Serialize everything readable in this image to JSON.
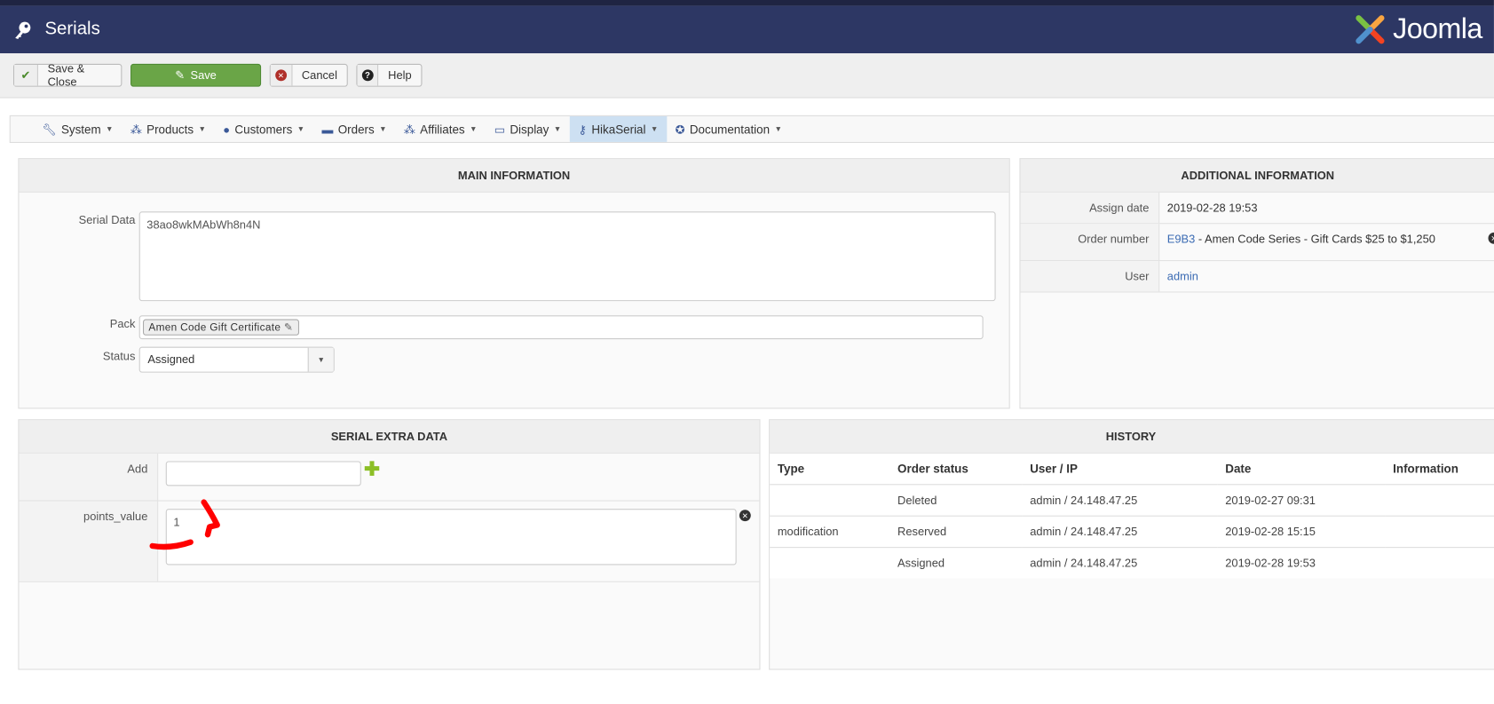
{
  "header": {
    "title": "Serials",
    "logo_text": "Joomla!"
  },
  "toolbar": {
    "save_close": "Save & Close",
    "save": "Save",
    "cancel": "Cancel",
    "help": "Help"
  },
  "menu": [
    {
      "label": "System",
      "icon": "wrench-icon"
    },
    {
      "label": "Products",
      "icon": "cubes-icon"
    },
    {
      "label": "Customers",
      "icon": "user-icon"
    },
    {
      "label": "Orders",
      "icon": "credit-card-icon"
    },
    {
      "label": "Affiliates",
      "icon": "users-icon"
    },
    {
      "label": "Display",
      "icon": "monitor-icon"
    },
    {
      "label": "HikaSerial",
      "icon": "key-icon",
      "active": true
    },
    {
      "label": "Documentation",
      "icon": "lifebuoy-icon"
    }
  ],
  "main": {
    "title": "MAIN INFORMATION",
    "serial_data_label": "Serial Data",
    "serial_data": "38ao8wkMAbWh8n4N",
    "pack_label": "Pack",
    "pack_value": "Amen Code Gift Certificate",
    "status_label": "Status",
    "status_value": "Assigned"
  },
  "additional": {
    "title": "ADDITIONAL INFORMATION",
    "assign_date_label": "Assign date",
    "assign_date": "2019-02-28 19:53",
    "order_number_label": "Order number",
    "order_number": "E9B3",
    "order_desc": " - Amen Code Series - Gift Cards $25 to $1,250",
    "user_label": "User",
    "user": "admin"
  },
  "extra": {
    "title": "SERIAL EXTRA DATA",
    "add_label": "Add",
    "add_value": "",
    "field_label": "points_value",
    "field_value": "1"
  },
  "history": {
    "title": "HISTORY",
    "columns": [
      "Type",
      "Order status",
      "User / IP",
      "Date",
      "Information"
    ],
    "rows": [
      [
        "",
        "Deleted",
        "admin / 24.148.47.25",
        "2019-02-27 09:31",
        ""
      ],
      [
        "modification",
        "Reserved",
        "admin / 24.148.47.25",
        "2019-02-28 15:15",
        ""
      ],
      [
        "",
        "Assigned",
        "admin / 24.148.47.25",
        "2019-02-28 19:53",
        ""
      ]
    ]
  },
  "colors": {
    "header": "#2d3764",
    "save": "#6aa547",
    "active_menu": "#cde0f2",
    "annotation": "#ff0000"
  }
}
